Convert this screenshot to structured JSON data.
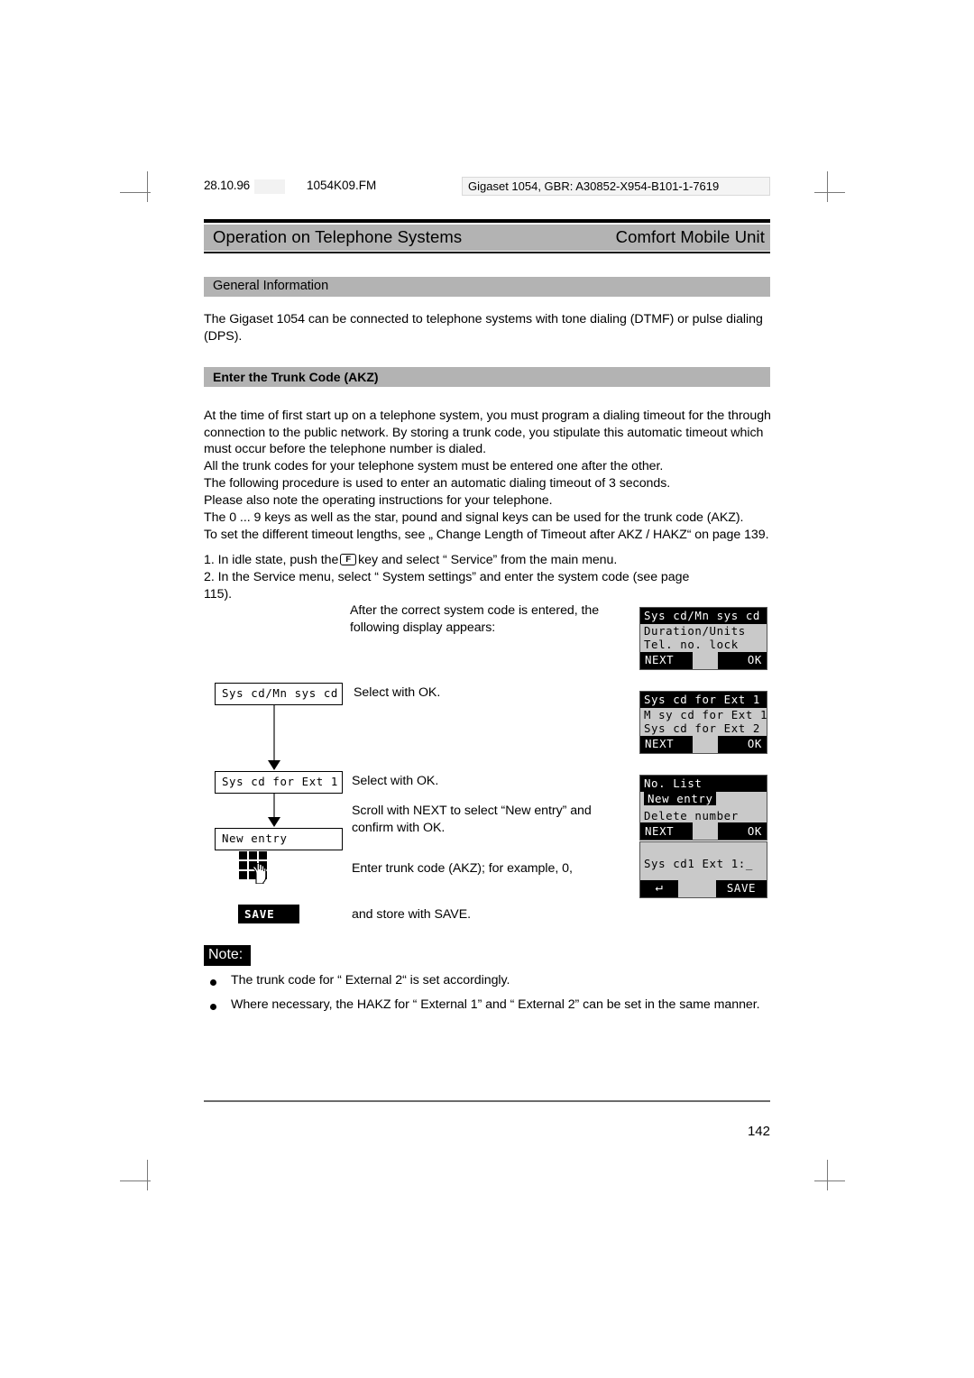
{
  "meta": {
    "date": "28.10.96",
    "filename": "1054K09.FM",
    "doc_ref": "Gigaset 1054, GBR: A30852-X954-B101-1-7619"
  },
  "running_head": {
    "left": "Operation on Telephone Systems",
    "right": "Comfort Mobile Unit"
  },
  "sections": {
    "general_information": "General Information",
    "enter_trunk_code": "Enter the Trunk Code (AKZ)"
  },
  "body": {
    "intro": "The Gigaset  1054 can be connected to telephone systems with tone dialing (DTMF) or pulse dialing (DPS).",
    "paragraph_1": "At the time of first start up on a telephone system, you must program a dialing timeout for the through connection to the public network. By storing a trunk code, you stipulate this automatic timeout which must occur before the telephone number is dialed.",
    "paragraph_2": "All the trunk codes for your telephone system must be entered one after the other.",
    "paragraph_3": "The following procedure is used to enter an automatic dialing timeout of 3 seconds.",
    "paragraph_4": "Please also note the operating instructions for your telephone.",
    "paragraph_5": "The 0 ... 9 keys as well as the star, pound and signal keys can be used for the trunk code (AKZ).",
    "paragraph_6": "To set the different timeout lengths, see „ Change Length of Timeout after AKZ / HAKZ“ on page 139.",
    "step_1_before": "1. In idle state, push the",
    "step_1_key": "F",
    "step_1_after": "key and select “ Service”  from the main menu.",
    "step_2": "2. In the Service menu, select “ System settings”  and enter the system code (see page 115)."
  },
  "captions": {
    "c1": "After the correct system code is entered, the following display appears:",
    "c2": "Select with OK.",
    "c3": "Select with OK.",
    "c4": "Scroll with NEXT to select “New entry” and confirm with OK.",
    "c5": "Enter trunk code (AKZ); for example, 0,",
    "c6": "and store with SAVE."
  },
  "flow_boxes": [
    {
      "label": "Sys cd/Mn sys cd"
    },
    {
      "label": "Sys cd for Ext 1"
    },
    {
      "label": "New entry"
    }
  ],
  "save_key_label": "SAVE",
  "displays": [
    {
      "title": "Sys cd/Mn sys cd",
      "rows": [
        "Duration/Units",
        "Tel. no. lock"
      ],
      "highlight_row": -1,
      "softkey_left": "NEXT",
      "softkey_right": "OK"
    },
    {
      "title": "Sys cd for Ext 1",
      "rows": [
        "M sy cd for Ext 1",
        "Sys cd for Ext 2"
      ],
      "highlight_row": -1,
      "softkey_left": "NEXT",
      "softkey_right": "OK"
    },
    {
      "title": "No. List",
      "rows": [
        "New entry",
        "Delete number"
      ],
      "highlight_row": 0,
      "softkey_left": "NEXT",
      "softkey_right": "OK"
    },
    {
      "title": "",
      "rows": [
        "Sys cd1 Ext 1:_"
      ],
      "highlight_row": -1,
      "softkey_left": "↵",
      "softkey_right": "SAVE"
    }
  ],
  "note": {
    "tag": "Note:",
    "items": [
      "The trunk code for “ External 2“  is set accordingly.",
      "Where necessary, the HAKZ for “ External 1”  and “ External 2”  can be set in the same manner."
    ]
  },
  "footer": {
    "page_number": "142"
  },
  "colors": {
    "bar_gray": "#b3b3b3",
    "lcd_bg": "#c9c9c9",
    "rule_black": "#000000"
  }
}
